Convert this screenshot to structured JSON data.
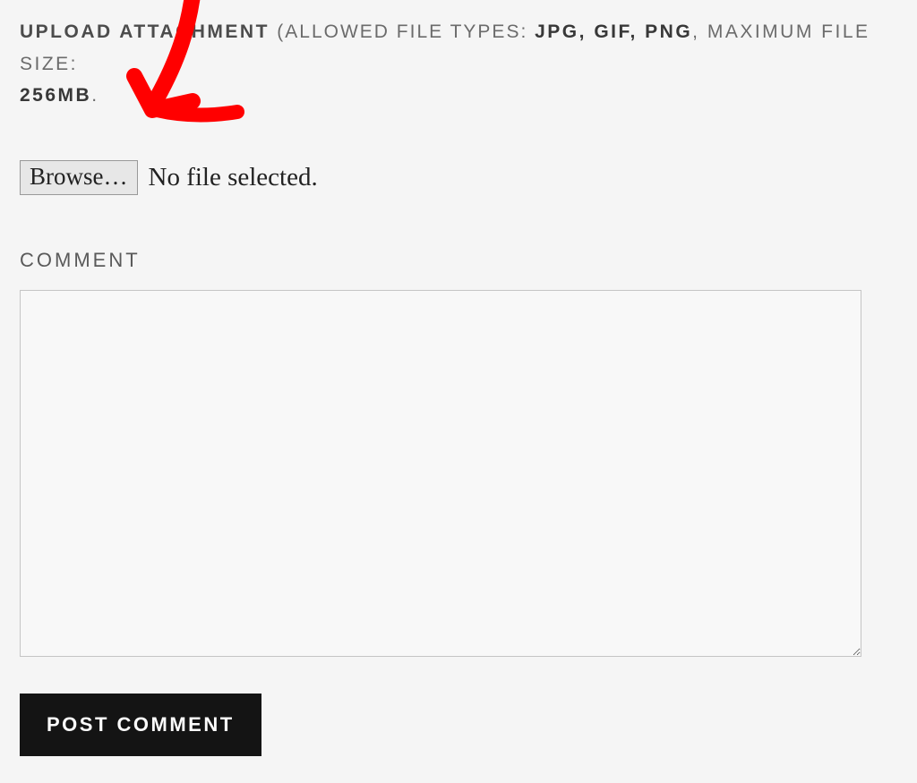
{
  "upload": {
    "label": "UPLOAD ATTACHMENT",
    "allowed_prefix": "(ALLOWED FILE TYPES: ",
    "allowed_types": "JPG, GIF, PNG",
    "size_prefix": ", MAXIMUM FILE SIZE: ",
    "size_value": "256MB",
    "size_suffix": "."
  },
  "file_picker": {
    "button_label": "Browse…",
    "status": "No file selected."
  },
  "comment": {
    "label": "COMMENT",
    "value": ""
  },
  "submit": {
    "label": "POST COMMENT"
  }
}
